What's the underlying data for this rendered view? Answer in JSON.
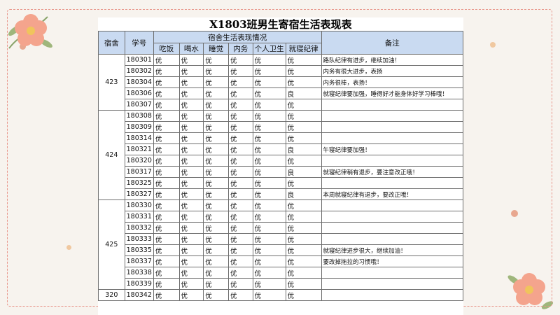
{
  "colors": {
    "background": "#f7f3ee",
    "border": "#e8958a",
    "header_fill": "#c9daf1"
  },
  "table": {
    "title": "X1803班男生寄宿生活表现表",
    "header": {
      "dorm": "宿舍",
      "student_id": "学号",
      "group": "宿舍生活表现情况",
      "remark": "备注",
      "categories": [
        "吃饭",
        "喝水",
        "睡觉",
        "内务",
        "个人卫生",
        "就寝纪律"
      ]
    },
    "groups": [
      {
        "dorm": "423",
        "rows": [
          {
            "id": "180301",
            "g": [
              "优",
              "优",
              "优",
              "优",
              "优",
              "优"
            ],
            "remark": "路队纪律有进步，继续加油！"
          },
          {
            "id": "180302",
            "g": [
              "优",
              "优",
              "优",
              "优",
              "优",
              "优"
            ],
            "remark": "内务有很大进步，表扬"
          },
          {
            "id": "180304",
            "g": [
              "优",
              "优",
              "优",
              "优",
              "优",
              "优"
            ],
            "remark": "内务很棒，表扬！"
          },
          {
            "id": "180306",
            "g": [
              "优",
              "优",
              "优",
              "优",
              "优",
              "良"
            ],
            "remark": "就寝纪律要加强，睡得好才能身体好学习棒哦！"
          },
          {
            "id": "180307",
            "g": [
              "优",
              "优",
              "优",
              "优",
              "优",
              "优"
            ],
            "remark": ""
          }
        ]
      },
      {
        "dorm": "424",
        "rows": [
          {
            "id": "180308",
            "g": [
              "优",
              "优",
              "优",
              "优",
              "优",
              "优"
            ],
            "remark": ""
          },
          {
            "id": "180309",
            "g": [
              "优",
              "优",
              "优",
              "优",
              "优",
              "优"
            ],
            "remark": ""
          },
          {
            "id": "180314",
            "g": [
              "优",
              "优",
              "优",
              "优",
              "优",
              "优"
            ],
            "remark": ""
          },
          {
            "id": "180321",
            "g": [
              "优",
              "优",
              "优",
              "优",
              "优",
              "良"
            ],
            "remark": "午寝纪律要加强！"
          },
          {
            "id": "180320",
            "g": [
              "优",
              "优",
              "优",
              "优",
              "优",
              "优"
            ],
            "remark": ""
          },
          {
            "id": "180317",
            "g": [
              "优",
              "优",
              "优",
              "优",
              "优",
              "良"
            ],
            "remark": "就寝纪律稍有退步，要注意改正哦！"
          },
          {
            "id": "180325",
            "g": [
              "优",
              "优",
              "优",
              "优",
              "优",
              "优"
            ],
            "remark": ""
          },
          {
            "id": "180327",
            "g": [
              "优",
              "优",
              "优",
              "优",
              "优",
              "良"
            ],
            "remark": "本周就寝纪律有退步，要改正哦！"
          }
        ]
      },
      {
        "dorm": "425",
        "rows": [
          {
            "id": "180330",
            "g": [
              "优",
              "优",
              "优",
              "优",
              "优",
              "优"
            ],
            "remark": ""
          },
          {
            "id": "180331",
            "g": [
              "优",
              "优",
              "优",
              "优",
              "优",
              "优"
            ],
            "remark": ""
          },
          {
            "id": "180332",
            "g": [
              "优",
              "优",
              "优",
              "优",
              "优",
              "优"
            ],
            "remark": ""
          },
          {
            "id": "180333",
            "g": [
              "优",
              "优",
              "优",
              "优",
              "优",
              "优"
            ],
            "remark": ""
          },
          {
            "id": "180335",
            "g": [
              "优",
              "优",
              "优",
              "优",
              "优",
              "优"
            ],
            "remark": "就寝纪律进步很大，继续加油！"
          },
          {
            "id": "180337",
            "g": [
              "优",
              "优",
              "优",
              "优",
              "优",
              "优"
            ],
            "remark": "要改掉拖拉的习惯哦！"
          },
          {
            "id": "180338",
            "g": [
              "优",
              "优",
              "优",
              "优",
              "优",
              "优"
            ],
            "remark": ""
          },
          {
            "id": "180339",
            "g": [
              "优",
              "优",
              "优",
              "优",
              "优",
              "优"
            ],
            "remark": ""
          }
        ]
      },
      {
        "dorm": "320",
        "rows": [
          {
            "id": "180342",
            "g": [
              "优",
              "优",
              "优",
              "优",
              "优",
              "优"
            ],
            "remark": ""
          }
        ]
      }
    ]
  }
}
